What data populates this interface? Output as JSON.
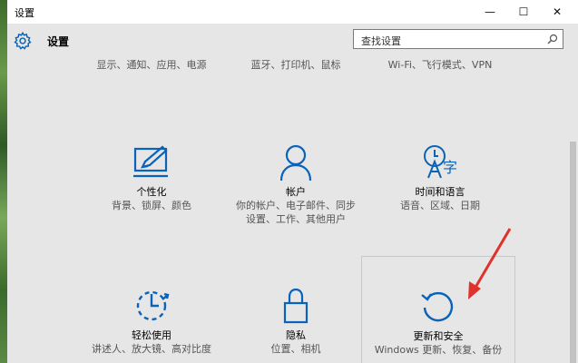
{
  "window": {
    "title": "设置",
    "buttons": {
      "minimize": "—",
      "maximize": "☐",
      "close": "✕"
    }
  },
  "header": {
    "app_name": "设置",
    "search": {
      "placeholder": "查找设置"
    }
  },
  "top_row": [
    {
      "desc": "显示、通知、应用、电源"
    },
    {
      "desc": "蓝牙、打印机、鼠标"
    },
    {
      "desc": "Wi-Fi、飞行模式、VPN"
    }
  ],
  "tiles": [
    {
      "title": "个性化",
      "desc": "背景、锁屏、颜色",
      "icon": "personalization-icon"
    },
    {
      "title": "帐户",
      "desc": "你的帐户、电子邮件、同步设置、工作、其他用户",
      "icon": "account-icon"
    },
    {
      "title": "时间和语言",
      "desc": "语音、区域、日期",
      "icon": "time-language-icon"
    },
    {
      "title": "轻松使用",
      "desc": "讲述人、放大镜、高对比度",
      "icon": "ease-of-access-icon"
    },
    {
      "title": "隐私",
      "desc": "位置、相机",
      "icon": "privacy-lock-icon"
    },
    {
      "title": "更新和安全",
      "desc": "Windows 更新、恢复、备份",
      "icon": "update-security-icon"
    }
  ],
  "colors": {
    "accent": "#0a63b8",
    "annotation": "#e0322b"
  }
}
